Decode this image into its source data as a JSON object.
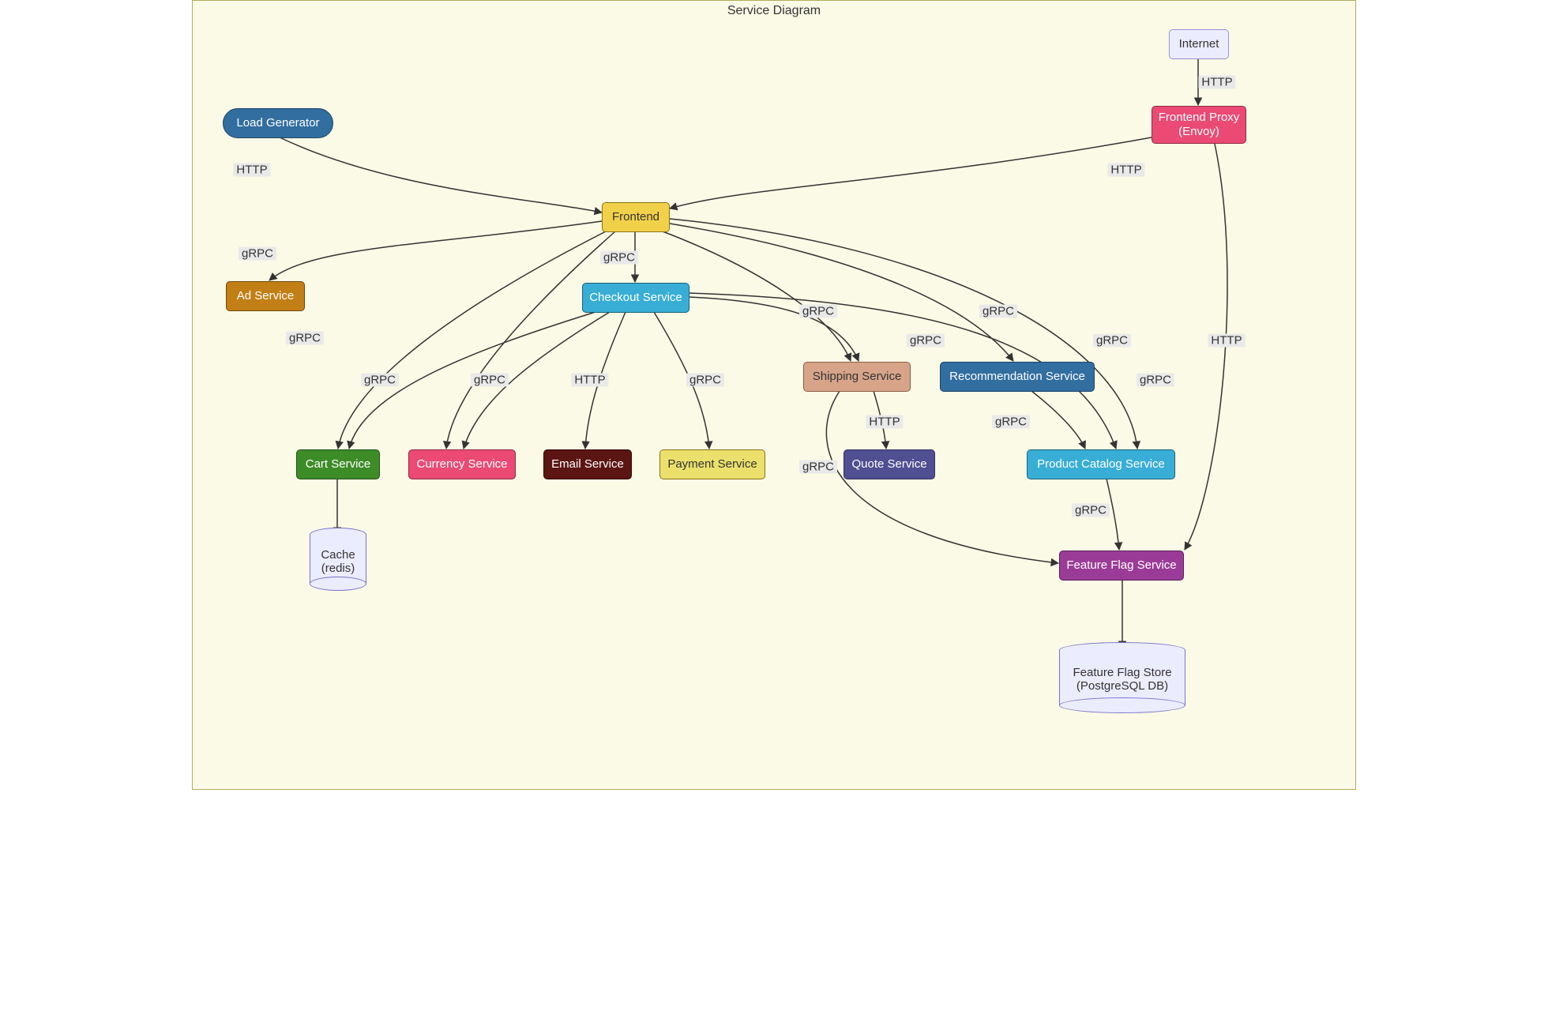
{
  "title": "Service Diagram",
  "protocol": {
    "http": "HTTP",
    "grpc": "gRPC"
  },
  "nodes": {
    "loadgen": {
      "label": "Load Generator",
      "bg": "#326ea0",
      "fg": "#fff",
      "border": "#1f4466",
      "shape": "stadium"
    },
    "internet": {
      "label": "Internet",
      "bg": "#ececff",
      "fg": "#333",
      "border": "#9b90d9",
      "shape": "rect"
    },
    "proxy": {
      "label": "Frontend Proxy\n(Envoy)",
      "bg": "#eb4a75",
      "fg": "#fff",
      "border": "#8c2b44",
      "shape": "rect"
    },
    "frontend": {
      "label": "Frontend",
      "bg": "#f2d14a",
      "fg": "#333",
      "border": "#8a7114",
      "shape": "rect"
    },
    "ad": {
      "label": "Ad Service",
      "bg": "#c27f15",
      "fg": "#fff",
      "border": "#6e480c",
      "shape": "rect"
    },
    "checkout": {
      "label": "Checkout Service",
      "bg": "#38aed6",
      "fg": "#fff",
      "border": "#1a6275",
      "shape": "rect"
    },
    "shipping": {
      "label": "Shipping Service",
      "bg": "#d7a48a",
      "fg": "#333",
      "border": "#8c6043",
      "shape": "rect"
    },
    "reco": {
      "label": "Recommendation Service",
      "bg": "#326ea0",
      "fg": "#fff",
      "border": "#1f4466",
      "shape": "rect"
    },
    "cart": {
      "label": "Cart Service",
      "bg": "#3d8c28",
      "fg": "#fff",
      "border": "#23511a",
      "shape": "rect"
    },
    "currency": {
      "label": "Currency Service",
      "bg": "#eb4a75",
      "fg": "#fff",
      "border": "#8c2b44",
      "shape": "rect"
    },
    "email": {
      "label": "Email Service",
      "bg": "#5b1513",
      "fg": "#fff",
      "border": "#2f0a09",
      "shape": "rect"
    },
    "payment": {
      "label": "Payment Service",
      "bg": "#ebe06c",
      "fg": "#333",
      "border": "#8a7114",
      "shape": "rect"
    },
    "quote": {
      "label": "Quote Service",
      "bg": "#4f4f92",
      "fg": "#fff",
      "border": "#2f2f5c",
      "shape": "rect"
    },
    "catalog": {
      "label": "Product Catalog Service",
      "bg": "#38aed6",
      "fg": "#fff",
      "border": "#1a6275",
      "shape": "rect"
    },
    "ffs": {
      "label": "Feature Flag Service",
      "bg": "#9a3c97",
      "fg": "#fff",
      "border": "#5a2258",
      "shape": "rect"
    },
    "cache": {
      "label": "Cache\n(redis)",
      "bg": "#ececff",
      "fg": "#333",
      "border": "#7a72c9",
      "shape": "cylinder"
    },
    "ffstore": {
      "label": "Feature Flag Store\n(PostgreSQL DB)",
      "bg": "#ececff",
      "fg": "#333",
      "border": "#7a72c9",
      "shape": "cylinder"
    }
  },
  "edges": [
    {
      "from": "internet",
      "to": "proxy",
      "label": "http"
    },
    {
      "from": "proxy",
      "to": "frontend",
      "label": "http"
    },
    {
      "from": "loadgen",
      "to": "frontend",
      "label": "http"
    },
    {
      "from": "frontend",
      "to": "ad",
      "label": "grpc"
    },
    {
      "from": "frontend",
      "to": "cart",
      "label": "grpc"
    },
    {
      "from": "frontend",
      "to": "checkout",
      "label": "grpc"
    },
    {
      "from": "frontend",
      "to": "currency",
      "label": "grpc"
    },
    {
      "from": "frontend",
      "to": "shipping",
      "label": "grpc"
    },
    {
      "from": "frontend",
      "to": "reco",
      "label": "grpc"
    },
    {
      "from": "frontend",
      "to": "catalog",
      "label": "grpc"
    },
    {
      "from": "checkout",
      "to": "cart",
      "label": "grpc"
    },
    {
      "from": "checkout",
      "to": "currency",
      "label": "grpc"
    },
    {
      "from": "checkout",
      "to": "email",
      "label": "http"
    },
    {
      "from": "checkout",
      "to": "payment",
      "label": "grpc"
    },
    {
      "from": "checkout",
      "to": "catalog",
      "label": "grpc"
    },
    {
      "from": "checkout",
      "to": "shipping",
      "label": "grpc"
    },
    {
      "from": "shipping",
      "to": "quote",
      "label": "http"
    },
    {
      "from": "reco",
      "to": "catalog",
      "label": "grpc"
    },
    {
      "from": "catalog",
      "to": "ffs",
      "label": "grpc"
    },
    {
      "from": "shipping",
      "to": "ffs",
      "label": "grpc"
    },
    {
      "from": "proxy",
      "to": "ffs",
      "label": "http"
    },
    {
      "from": "cart",
      "to": "cache",
      "label": ""
    },
    {
      "from": "ffs",
      "to": "ffstore",
      "label": ""
    }
  ]
}
